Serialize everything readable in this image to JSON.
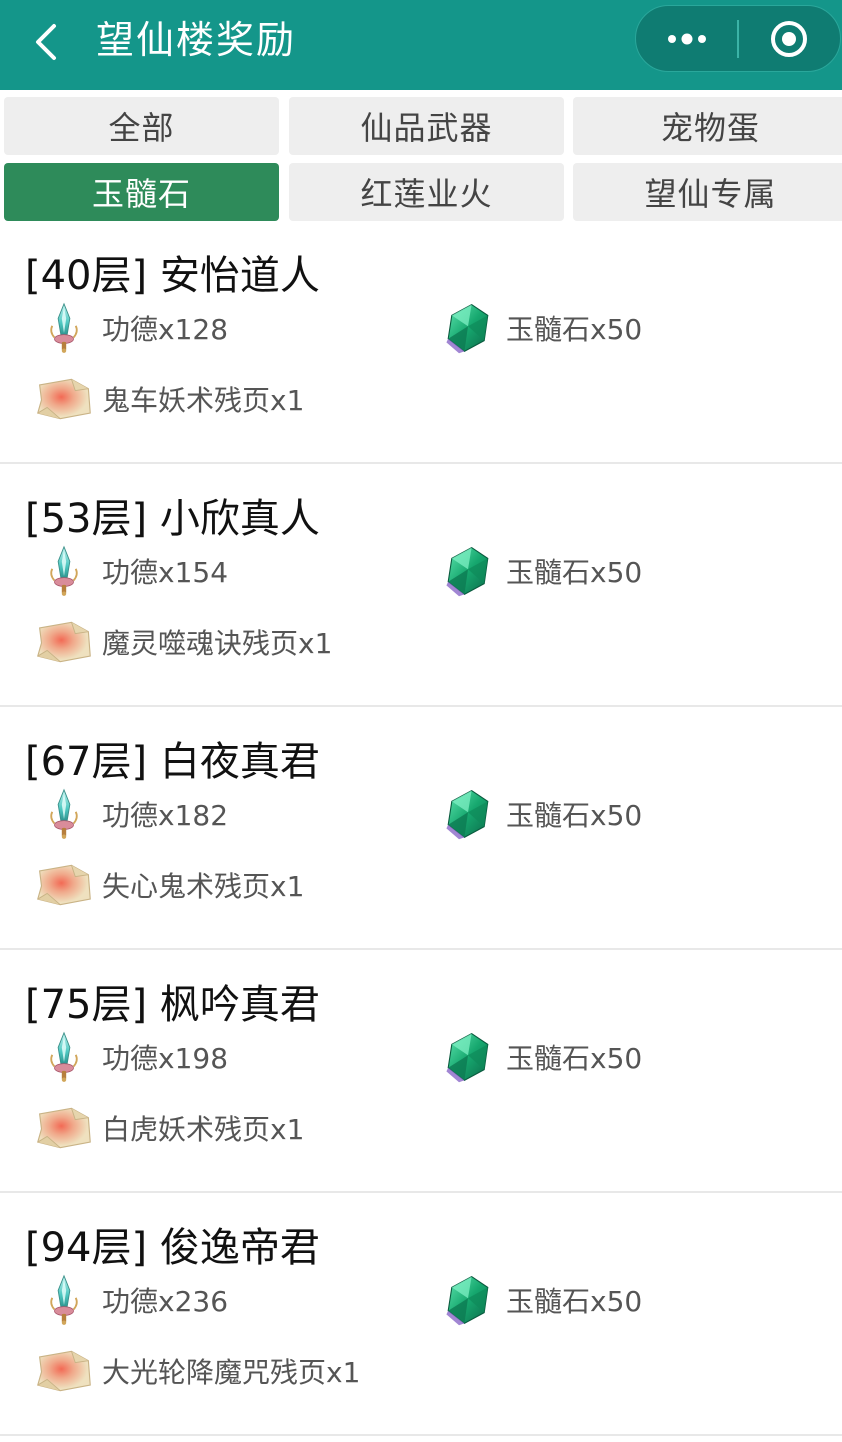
{
  "header": {
    "title": "望仙楼奖励",
    "back_icon": "chevron-left-icon",
    "more_icon": "more-dots-icon",
    "close_icon": "target-circle-icon",
    "bg_color": "#14968a"
  },
  "tabs": [
    {
      "label": "全部",
      "active": false
    },
    {
      "label": "仙品武器",
      "active": false
    },
    {
      "label": "宠物蛋",
      "active": false
    },
    {
      "label": "玉髓石",
      "active": true
    },
    {
      "label": "红莲业火",
      "active": false
    },
    {
      "label": "望仙专属",
      "active": false
    }
  ],
  "accent_color": "#2e8b5a",
  "sections": [
    {
      "title": "[40层] 安怡道人",
      "rewards": [
        {
          "icon": "merit-sword-icon",
          "label": "功德x128"
        },
        {
          "icon": "jade-stone-icon",
          "label": "玉髓石x50"
        },
        {
          "icon": "scroll-page-icon",
          "label": "鬼车妖术残页x1"
        }
      ]
    },
    {
      "title": "[53层] 小欣真人",
      "rewards": [
        {
          "icon": "merit-sword-icon",
          "label": "功德x154"
        },
        {
          "icon": "jade-stone-icon",
          "label": "玉髓石x50"
        },
        {
          "icon": "scroll-page-icon",
          "label": "魔灵噬魂诀残页x1"
        }
      ]
    },
    {
      "title": "[67层] 白夜真君",
      "rewards": [
        {
          "icon": "merit-sword-icon",
          "label": "功德x182"
        },
        {
          "icon": "jade-stone-icon",
          "label": "玉髓石x50"
        },
        {
          "icon": "scroll-page-icon",
          "label": "失心鬼术残页x1"
        }
      ]
    },
    {
      "title": "[75层] 枫吟真君",
      "rewards": [
        {
          "icon": "merit-sword-icon",
          "label": "功德x198"
        },
        {
          "icon": "jade-stone-icon",
          "label": "玉髓石x50"
        },
        {
          "icon": "scroll-page-icon",
          "label": "白虎妖术残页x1"
        }
      ]
    },
    {
      "title": "[94层] 俊逸帝君",
      "rewards": [
        {
          "icon": "merit-sword-icon",
          "label": "功德x236"
        },
        {
          "icon": "jade-stone-icon",
          "label": "玉髓石x50"
        },
        {
          "icon": "scroll-page-icon",
          "label": "大光轮降魔咒残页x1"
        }
      ]
    }
  ]
}
